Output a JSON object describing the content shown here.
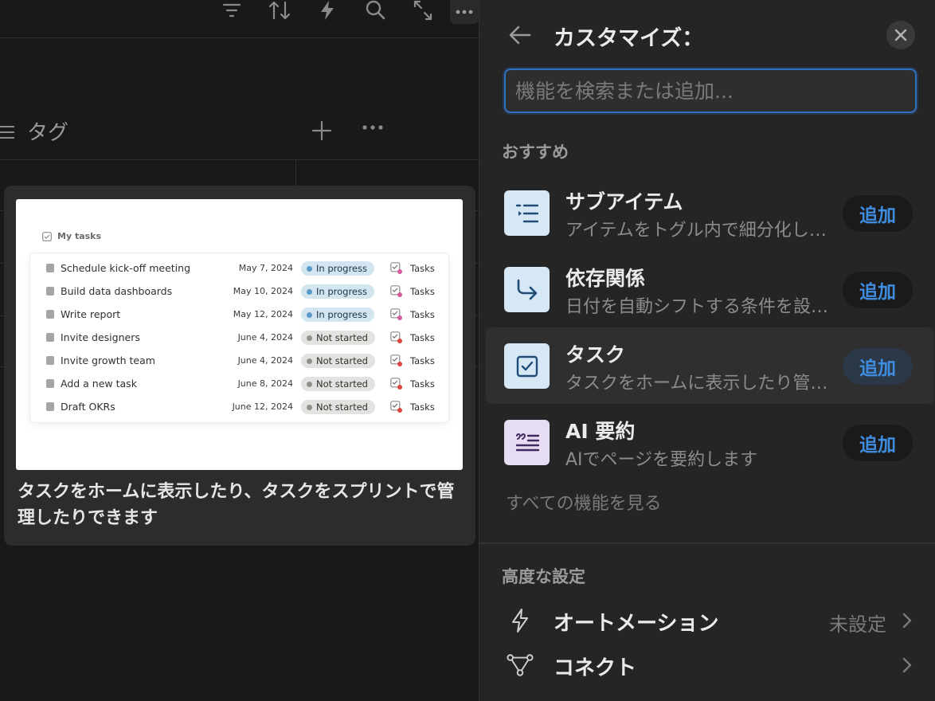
{
  "colors": {
    "background": "#191919",
    "panel": "#252525",
    "accent": "#3f8de0",
    "focus_border": "#2f6fc4"
  },
  "toolbar": {
    "icons": [
      "filter-icon",
      "sort-icon",
      "lightning-icon",
      "search-icon",
      "expand-icon",
      "more-icon"
    ]
  },
  "property": {
    "label": "タグ"
  },
  "preview": {
    "heading": "My tasks",
    "rows": [
      {
        "name": "Schedule kick-off meeting",
        "date": "May 7, 2024",
        "status": "In progress",
        "tag": "Tasks"
      },
      {
        "name": "Build data dashboards",
        "date": "May 10, 2024",
        "status": "In progress",
        "tag": "Tasks"
      },
      {
        "name": "Write report",
        "date": "May 12, 2024",
        "status": "In progress",
        "tag": "Tasks"
      },
      {
        "name": "Invite designers",
        "date": "June 4, 2024",
        "status": "Not started",
        "tag": "Tasks"
      },
      {
        "name": "Invite growth team",
        "date": "June 4, 2024",
        "status": "Not started",
        "tag": "Tasks"
      },
      {
        "name": "Add a new task",
        "date": "June 8, 2024",
        "status": "Not started",
        "tag": "Tasks"
      },
      {
        "name": "Draft OKRs",
        "date": "June 12, 2024",
        "status": "Not started",
        "tag": "Tasks"
      }
    ],
    "caption": "タスクをホームに表示したり、タスクをスプリントで管理したりできます"
  },
  "panel": {
    "title": "カスタマイズ：",
    "search_placeholder": "機能を検索または追加...",
    "recommended_label": "おすすめ",
    "features": [
      {
        "title": "サブアイテム",
        "description": "アイテムをトグル内で細分化します",
        "icon": "sub-items-icon",
        "button": "追加"
      },
      {
        "title": "依存関係",
        "description": "日付を自動シフトする条件を設定します",
        "icon": "dependency-arrow-icon",
        "button": "追加"
      },
      {
        "title": "タスク",
        "description": "タスクをホームに表示したり管理したりします",
        "icon": "task-checkbox-icon",
        "button": "追加"
      },
      {
        "title": "AI 要約",
        "description": "AIでページを要約します",
        "icon": "ai-summary-icon",
        "button": "追加"
      }
    ],
    "see_all": "すべての機能を見る",
    "advanced_label": "高度な設定",
    "settings": [
      {
        "label": "オートメーション",
        "value": "未設定",
        "icon": "lightning-icon"
      },
      {
        "label": "コネクト",
        "value": "",
        "icon": "connect-icon"
      }
    ]
  }
}
